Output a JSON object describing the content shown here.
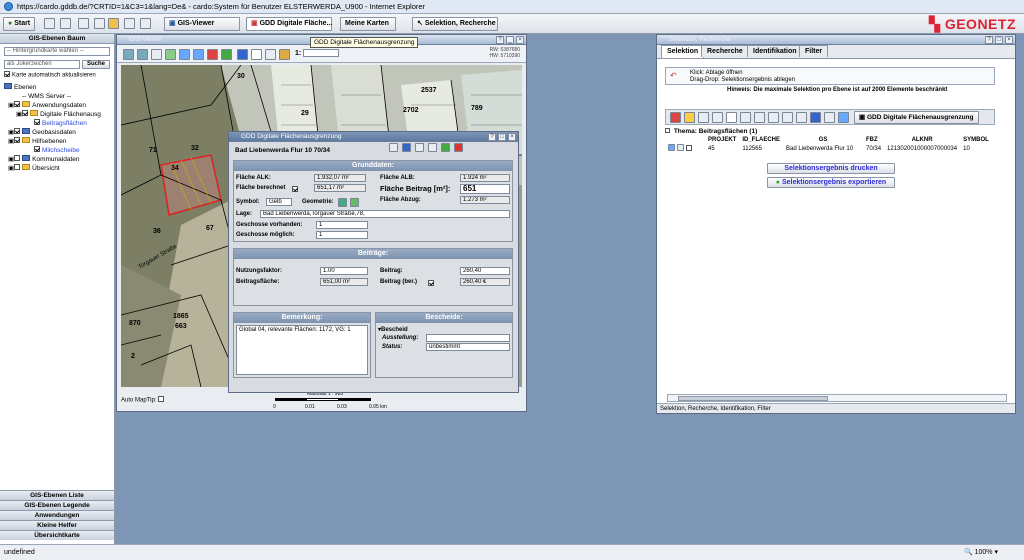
{
  "window": {
    "title": "https://cardo.gddb.de/?CRTID=1&C3=1&lang=De& - cardo:System für Benutzer ELSTERWERDA_U900 - Internet Explorer"
  },
  "toolbar": {
    "start": "Start",
    "gis_viewer": "GIS-Viewer",
    "gdd_btn": "GDD Digitale Fläche...",
    "meine_karten": "Meine Karten",
    "selektion": "Selektion, Recherche",
    "tooltip": "GDD Digitale Flächenausgrenzung",
    "logo": "GEONETZ"
  },
  "left": {
    "header": "GIS-Ebenen Baum",
    "background_select": "-- Hintergrundkarte wählen --",
    "search_placeholder": "als Jokerzeichen",
    "search_btn": "Suche",
    "auto_update": "Karte automatisch aktualisieren",
    "tree": [
      "Ebenen",
      "-- WMS Server --",
      "Anwendungsdaten",
      "Digitale Flächenausg",
      "Beitragsflächen",
      "Geobasisdaten",
      "Hilfsebenen",
      "Milchscheibe",
      "Kommunaldaten",
      "Übersicht"
    ],
    "accordion": [
      "GIS-Ebenen Liste",
      "GIS-Ebenen Legende",
      "Anwendungen",
      "Kleine Helfer",
      "Übersichtkarte"
    ]
  },
  "gisviewer": {
    "title": "GIS-Viewer",
    "scale_prefix": "1:",
    "rw": "RW: 5387680",
    "hw": "HW: 5710390",
    "automaptip": "Auto MapTip:",
    "massstab": "Maßstab 1 : 985",
    "scale_labels": [
      "0",
      "0.01",
      "0.03",
      "0.05 km"
    ],
    "map_labels": [
      "30",
      "34",
      "71",
      "38",
      "32",
      "36",
      "67",
      "29",
      "2701",
      "2702",
      "2537",
      "789",
      "662",
      "870",
      "2",
      "1865",
      "663",
      "Torgauer Straße"
    ]
  },
  "dialog": {
    "title": "GDD Digitale Flächenausgrenzung",
    "location": "Bad Liebenwerda Flur 10 70/34",
    "grunddaten": "Grunddaten:",
    "flaeche_alk_l": "Fläche ALK:",
    "flaeche_alk": "1.932,07 m²",
    "flaeche_alb_l": "Fläche ALB:",
    "flaeche_alb": "1.924 m²",
    "flaeche_ber_l": "Fläche berechnet",
    "flaeche_ber": "651,17 m²",
    "flaeche_beitrag_l": "Fläche Beitrag [m²]:",
    "flaeche_beitrag": "651",
    "flaeche_abzug_l": "Fläche Abzug:",
    "flaeche_abzug": "1.273 m²",
    "symbol_l": "Symbol:",
    "symbol": "Gelb",
    "geometrie_l": "Geometrie:",
    "lage_l": "Lage:",
    "lage": "Bad Liebenwerda,Torgauer Straße,78,",
    "gesch_vorh_l": "Geschosse vorhanden:",
    "gesch_vorh": "1",
    "gesch_mogl_l": "Geschosse möglich:",
    "gesch_mogl": "1",
    "beitraege": "Beiträge:",
    "nutzung_l": "Nutzungsfaktor:",
    "nutzung": "1.00",
    "beitrag_l": "Beitrag:",
    "beitrag": "260,40",
    "beitragsfl_l": "Beitragsfläche:",
    "beitragsfl": "651,00 m²",
    "beitrag_ber_l": "Beitrag (ber.)",
    "beitrag_ber": "260,40 €",
    "bemerkung": "Bemerkung:",
    "bemerkung_text": "Global 04, relevante Flächen: 1172, VG: 1",
    "bescheide": "Bescheide:",
    "bescheid": "Bescheid",
    "ausstellung_l": "Ausstellung:",
    "status_l": "Status:",
    "status": "unbestimmt"
  },
  "selection": {
    "title": "Selektion, Recherche",
    "tabs": [
      "Selektion",
      "Recherche",
      "Identifikation",
      "Filter"
    ],
    "hint1": "Klick: Ablage öffnen",
    "hint2": "Drag-Drop: Selektionsergebnis ablegen",
    "hint3": "Hinweis: Die maximale Selektion pro Ebene ist auf 2000 Elemente beschränkt",
    "gdd_btn": "GDD Digitale Flächenausgrenzung",
    "thema": "Thema: Beitragsflächen (1)",
    "columns": [
      "PROJEKT",
      "ID_FLAECHE",
      "GS",
      "FBZ",
      "ALKNR",
      "SYMBOL"
    ],
    "row": [
      "45",
      "112565",
      "Bad Liebenwerda Flur 10",
      "70/34",
      "121302001000007000034",
      "10"
    ],
    "print_btn": "Selektionsergebnis drucken",
    "export_btn": "Selektionsergebnis exportieren",
    "footer": "Selektion, Recherche, Identifikation, Filter"
  },
  "status": {
    "left": "undefined",
    "zoom": "100%"
  }
}
